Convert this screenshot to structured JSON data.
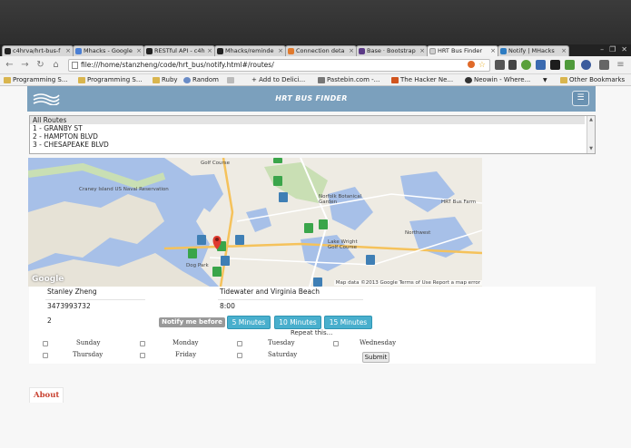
{
  "browser": {
    "tabs": [
      {
        "label": "c4hrva/hrt-bus-f",
        "fav_color": "#222222"
      },
      {
        "label": "Mhacks - Google",
        "fav_color": "#4a7fd4"
      },
      {
        "label": "RESTful API - c4h",
        "fav_color": "#222222"
      },
      {
        "label": "Mhacks/reminde",
        "fav_color": "#222222"
      },
      {
        "label": "Connection deta",
        "fav_color": "#e07a2e"
      },
      {
        "label": "Base · Bootstrap",
        "fav_color": "#5b3a86"
      },
      {
        "label": "HRT Bus Finder",
        "fav_color": "#cfcfcf"
      },
      {
        "label": "Notify | MHacks",
        "fav_color": "#2d7cc2"
      }
    ],
    "url": "file:///home/stanzheng/code/hrt_bus/notify.html#/routes/",
    "bookmarks": [
      {
        "label": "Programming S..."
      },
      {
        "label": "Programming S..."
      },
      {
        "label": "Ruby"
      },
      {
        "label": "Random"
      },
      {
        "label": "+ Add to Delici..."
      },
      {
        "label": "Pastebin.com -..."
      },
      {
        "label": "The Hacker Ne..."
      },
      {
        "label": "Neowin - Where..."
      },
      {
        "label": "Other Bookmarks"
      }
    ]
  },
  "app": {
    "title": "HRT BUS FINDER",
    "menu_icon": "list-icon",
    "routes": [
      "All Routes",
      "1 - GRANBY ST",
      "2 - HAMPTON BLVD",
      "3 - CHESAPEAKE BLVD"
    ]
  },
  "map": {
    "brand": "Google",
    "attribution": "Map data ©2013 Google   Terms of Use   Report a map error",
    "labels": [
      "Craney Island US Naval Reservation",
      "Norfolk Botanical Garden",
      "HRT Bus Farm",
      "Lake Wright Golf Course",
      "Northwest",
      "Golf Course",
      "Dog Park"
    ]
  },
  "form": {
    "name": "Stanley Zheng",
    "location": "Tidewater and Virginia Beach",
    "phone": "3473993732",
    "time": "8:00",
    "count": "2",
    "notify_label": "Notify me before",
    "buttons": [
      "5 Minutes",
      "10 Minutes",
      "15 Minutes"
    ],
    "repeat_label": "Repeat this...",
    "days": [
      "Sunday",
      "Monday",
      "Tuesday",
      "Wednesday",
      "Thursday",
      "Friday",
      "Saturday"
    ],
    "submit_label": "Submit"
  },
  "footer": {
    "about": "About"
  },
  "colors": {
    "nav": "#7ba0bd",
    "button": "#49afcd",
    "accent": "#c8402f"
  }
}
